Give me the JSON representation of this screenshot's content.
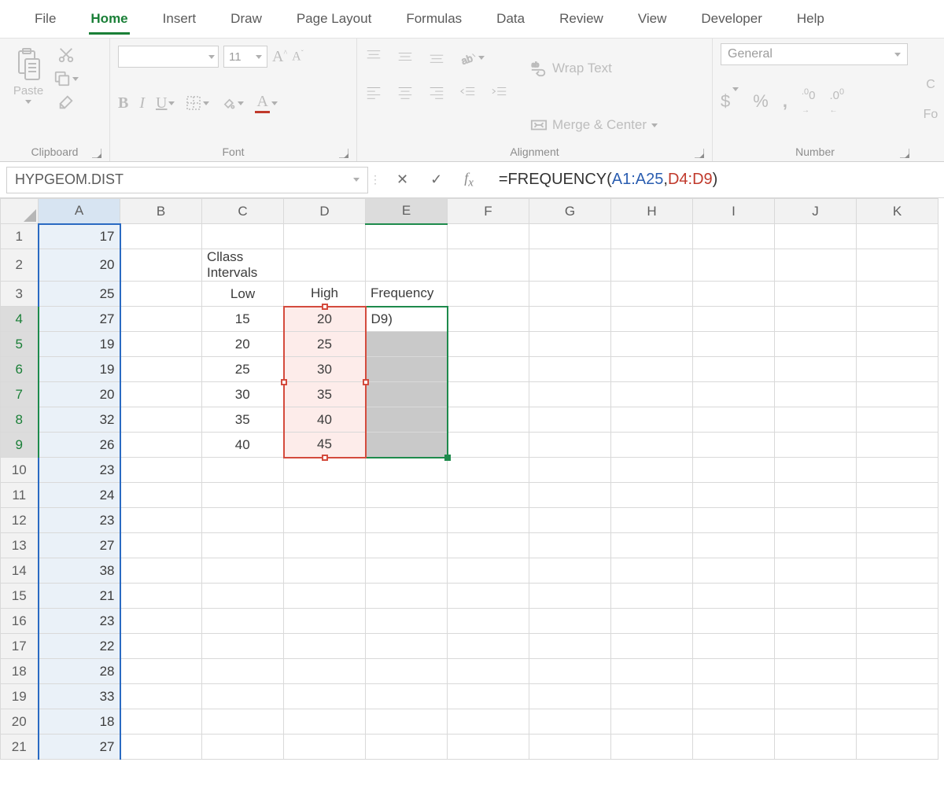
{
  "menu": {
    "tabs": [
      "File",
      "Home",
      "Insert",
      "Draw",
      "Page Layout",
      "Formulas",
      "Data",
      "Review",
      "View",
      "Developer",
      "Help"
    ],
    "active": "Home"
  },
  "ribbon": {
    "clipboard": {
      "paste": "Paste",
      "label": "Clipboard"
    },
    "font": {
      "size": "11",
      "label": "Font",
      "bold": "B",
      "italic": "I",
      "underline": "U"
    },
    "alignment": {
      "wrap": "Wrap Text",
      "merge": "Merge & Center",
      "label": "Alignment"
    },
    "number": {
      "format": "General",
      "label": "Number"
    },
    "cond": {
      "label1": "C",
      "label2": "Fo"
    }
  },
  "formula_bar": {
    "namebox": "HYPGEOM.DIST",
    "formula_prefix": "=FREQUENCY(",
    "ref1": "A1:A25",
    "comma": ",",
    "ref2": "D4:D9",
    "formula_suffix": ")"
  },
  "columns": [
    "A",
    "B",
    "C",
    "D",
    "E",
    "F",
    "G",
    "H",
    "I",
    "J",
    "K"
  ],
  "labels": {
    "class_intervals": "Cllass Intervals",
    "low": "Low",
    "high": "High",
    "frequency": "Frequency",
    "e4_text": "D9)"
  },
  "colA_values": [
    17,
    20,
    25,
    27,
    19,
    19,
    20,
    32,
    26,
    23,
    24,
    23,
    27,
    38,
    21,
    23,
    22,
    28,
    33,
    18,
    27
  ],
  "intervals": {
    "low": [
      15,
      20,
      25,
      30,
      35,
      40
    ],
    "high": [
      20,
      25,
      30,
      35,
      40,
      45
    ]
  },
  "num_rows": 21
}
